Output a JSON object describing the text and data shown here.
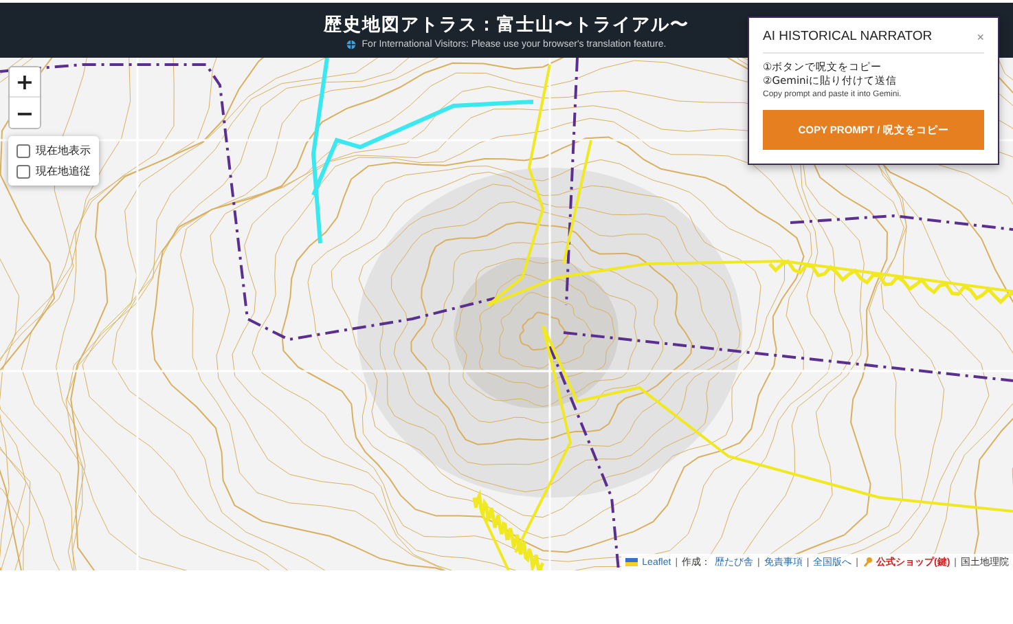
{
  "header": {
    "title": "歴史地図アトラス：富士山〜トライアル〜",
    "notice": "For International Visitors: Please use your browser's translation feature."
  },
  "zoom_controls": [
    {
      "label": "+"
    },
    {
      "label": "−"
    }
  ],
  "location_options": [
    {
      "label": "現在地表示",
      "checked": false
    },
    {
      "label": "現在地追従",
      "checked": false
    }
  ],
  "narrator_panel": {
    "title": "AI HISTORICAL NARRATOR",
    "close": "×",
    "steps": [
      "①ボタンで呪文をコピー",
      "②Geminiに貼り付けて送信"
    ],
    "note": "Copy prompt and paste it into Gemini.",
    "button": "COPY PROMPT / 呪文をコピー"
  },
  "attribution": {
    "separator": "|",
    "segments": [
      {
        "parts": [
          {
            "kind": "leaflet",
            "text": "Leaflet"
          }
        ]
      },
      {
        "parts": [
          {
            "kind": "text",
            "text": "作成："
          },
          {
            "kind": "link",
            "text": "歴たび舎"
          }
        ]
      },
      {
        "parts": [
          {
            "kind": "link",
            "text": "免責事項"
          }
        ]
      },
      {
        "parts": [
          {
            "kind": "link",
            "text": "全国版へ"
          }
        ]
      },
      {
        "parts": [
          {
            "kind": "shop",
            "text": "公式ショップ(鍵)"
          }
        ]
      },
      {
        "parts": [
          {
            "kind": "text",
            "text": "国土地理院"
          }
        ]
      }
    ]
  }
}
